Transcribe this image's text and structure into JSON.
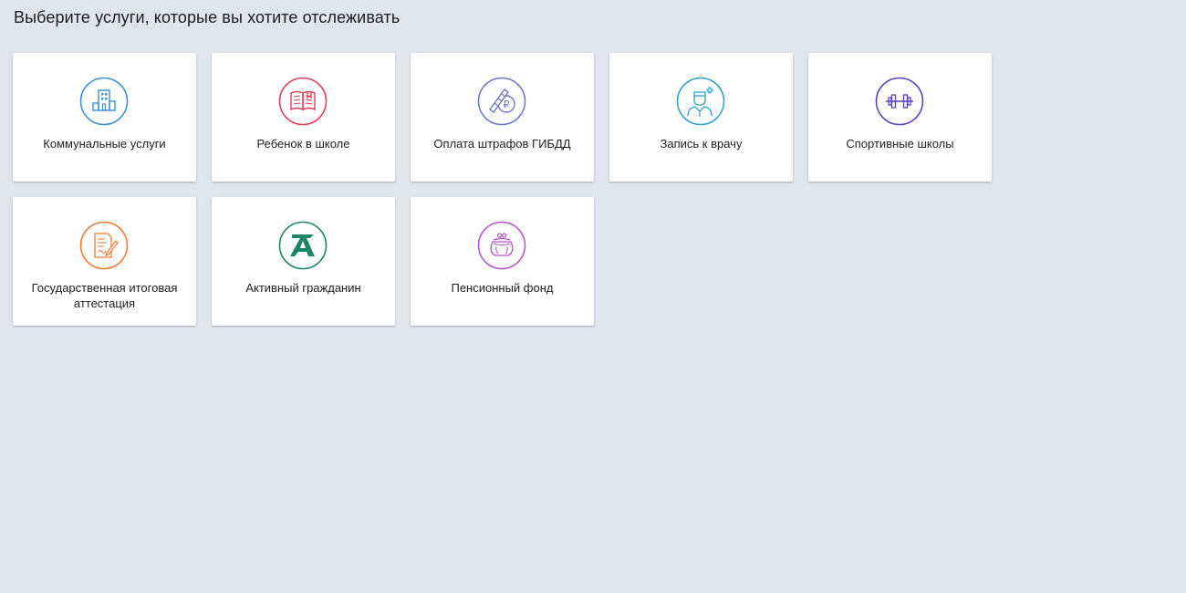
{
  "page": {
    "title": "Выберите услуги, которые вы хотите отслеживать"
  },
  "services": [
    {
      "label": "Коммунальные услуги",
      "icon": "building-icon",
      "color": "#3d8fd6"
    },
    {
      "label": "Ребенок в школе",
      "icon": "book-icon",
      "color": "#e03c57"
    },
    {
      "label": "Оплата штрафов ГИБДД",
      "icon": "baton-ruble-icon",
      "color": "#6e76c4"
    },
    {
      "label": "Запись к врачу",
      "icon": "doctor-icon",
      "color": "#2aa1c9"
    },
    {
      "label": "Спортивные школы",
      "icon": "dumbbell-icon",
      "color": "#5b3fc2"
    },
    {
      "label": "Государственная итоговая аттестация",
      "icon": "exam-icon",
      "color": "#ef7a34"
    },
    {
      "label": "Активный гражданин",
      "icon": "active-citizen-icon",
      "color": "#1d8468"
    },
    {
      "label": "Пенсионный фонд",
      "icon": "purse-icon",
      "color": "#b855c9"
    }
  ]
}
